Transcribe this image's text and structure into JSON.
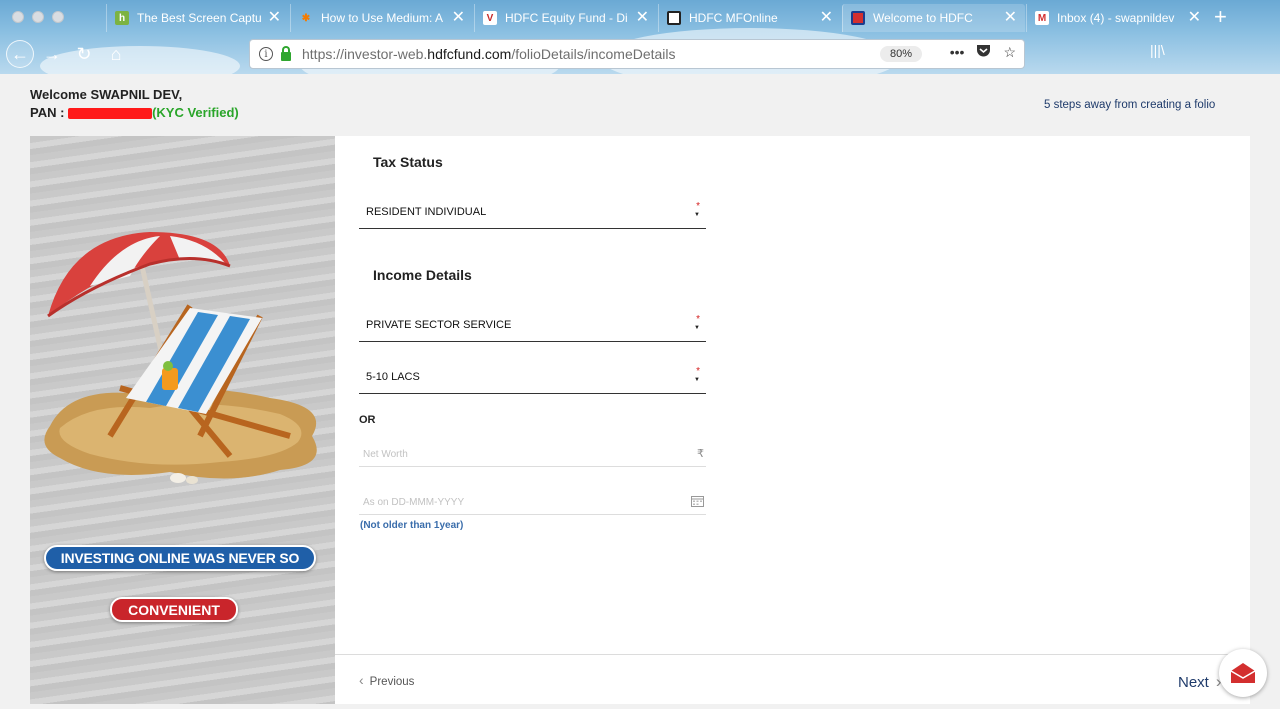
{
  "browser": {
    "tabs": [
      {
        "title": "The Best Screen Captu",
        "close": "✕",
        "icon": "hubspot-like-green-icon"
      },
      {
        "title": "How to Use Medium: A",
        "close": "✕",
        "icon": "orange-sprocket-icon"
      },
      {
        "title": "HDFC Equity Fund - Di",
        "close": "✕",
        "icon": "vr-icon"
      },
      {
        "title": "HDFC MFOnline",
        "close": "✕",
        "icon": "hdfc-square-icon"
      },
      {
        "title": "Welcome to HDFC",
        "close": "✕",
        "icon": "hdfc-red-icon"
      },
      {
        "title": "Inbox (4) - swapnildev",
        "close": "✕",
        "icon": "gmail-icon"
      }
    ],
    "new_tab": "+",
    "url_scheme": "https://investor-web.",
    "url_host": "hdfcfund.com",
    "url_path": "/folioDetails/incomeDetails",
    "zoom": "80%",
    "menu_dots": "•••"
  },
  "header": {
    "welcome": "Welcome SWAPNIL DEV,",
    "pan_label": "PAN :",
    "kyc": "(KYC Verified)",
    "steps": "5 steps away from creating a folio"
  },
  "banner": {
    "line1": "INVESTING ONLINE WAS NEVER SO",
    "line2": "CONVENIENT"
  },
  "form": {
    "tax_status_title": "Tax Status",
    "tax_status_value": "RESIDENT INDIVIDUAL",
    "income_title": "Income Details",
    "occupation_value": "PRIVATE SECTOR SERVICE",
    "income_range_value": "5-10 LACS",
    "required_mark": "*",
    "caret": "▼",
    "or_label": "OR",
    "net_worth_placeholder": "Net Worth",
    "currency_symbol": "₹",
    "as_on_placeholder": "As on DD-MMM-YYYY",
    "date_note": "(Not older than 1year)"
  },
  "footer": {
    "previous": "Previous",
    "next": "Next"
  },
  "colors": {
    "accent_navy": "#1f3b6b",
    "required_red": "#d42020",
    "kyc_green": "#2aa52a",
    "note_blue": "#3a6dab"
  }
}
